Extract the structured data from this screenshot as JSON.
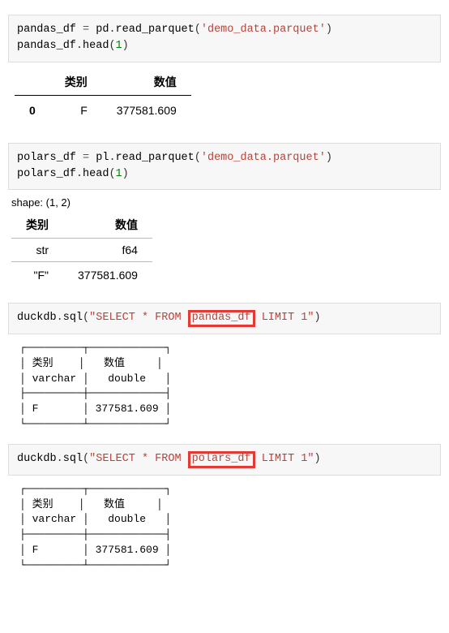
{
  "cell1": {
    "line1_parts": {
      "var": "pandas_df",
      "eq": " = ",
      "mod": "pd",
      "dot": ".",
      "fn": "read_parquet",
      "lp": "(",
      "str": "'demo_data.parquet'",
      "rp": ")"
    },
    "line2_parts": {
      "var": "pandas_df",
      "dot": ".",
      "fn": "head",
      "lp": "(",
      "num": "1",
      "rp": ")"
    }
  },
  "pandas_table": {
    "headers": [
      "",
      "类别",
      "数值"
    ],
    "row": [
      "0",
      "F",
      "377581.609"
    ]
  },
  "cell2": {
    "line1_parts": {
      "var": "polars_df",
      "eq": " = ",
      "mod": "pl",
      "dot": ".",
      "fn": "read_parquet",
      "lp": "(",
      "str": "'demo_data.parquet'",
      "rp": ")"
    },
    "line2_parts": {
      "var": "polars_df",
      "dot": ".",
      "fn": "head",
      "lp": "(",
      "num": "1",
      "rp": ")"
    }
  },
  "polars_shape": "shape: (1, 2)",
  "polars_table": {
    "headers": [
      "类别",
      "数值"
    ],
    "dtypes": [
      "str",
      "f64"
    ],
    "row": [
      "\"F\"",
      "377581.609"
    ]
  },
  "cell3": {
    "pre": "duckdb",
    "dot": ".",
    "fn": "sql",
    "lp": "(",
    "s1": "\"SELECT * FROM ",
    "boxed": "pandas_df",
    "s2": " LIMIT 1\"",
    "rp": ")"
  },
  "duck_out1": {
    "l1": "┌─────────┬────────────┐",
    "l2": "│ 类别    │   数值     │",
    "l3": "│ varchar │   double   │",
    "l4": "├─────────┼────────────┤",
    "l5": "│ F       │ 377581.609 │",
    "l6": "└─────────┴────────────┘"
  },
  "cell4": {
    "pre": "duckdb",
    "dot": ".",
    "fn": "sql",
    "lp": "(",
    "s1": "\"SELECT * FROM ",
    "boxed": "polars_df",
    "s2": " LIMIT 1\"",
    "rp": ")"
  },
  "duck_out2": {
    "l1": "┌─────────┬────────────┐",
    "l2": "│ 类别    │   数值     │",
    "l3": "│ varchar │   double   │",
    "l4": "├─────────┼────────────┤",
    "l5": "│ F       │ 377581.609 │",
    "l6": "└─────────┴────────────┘"
  }
}
